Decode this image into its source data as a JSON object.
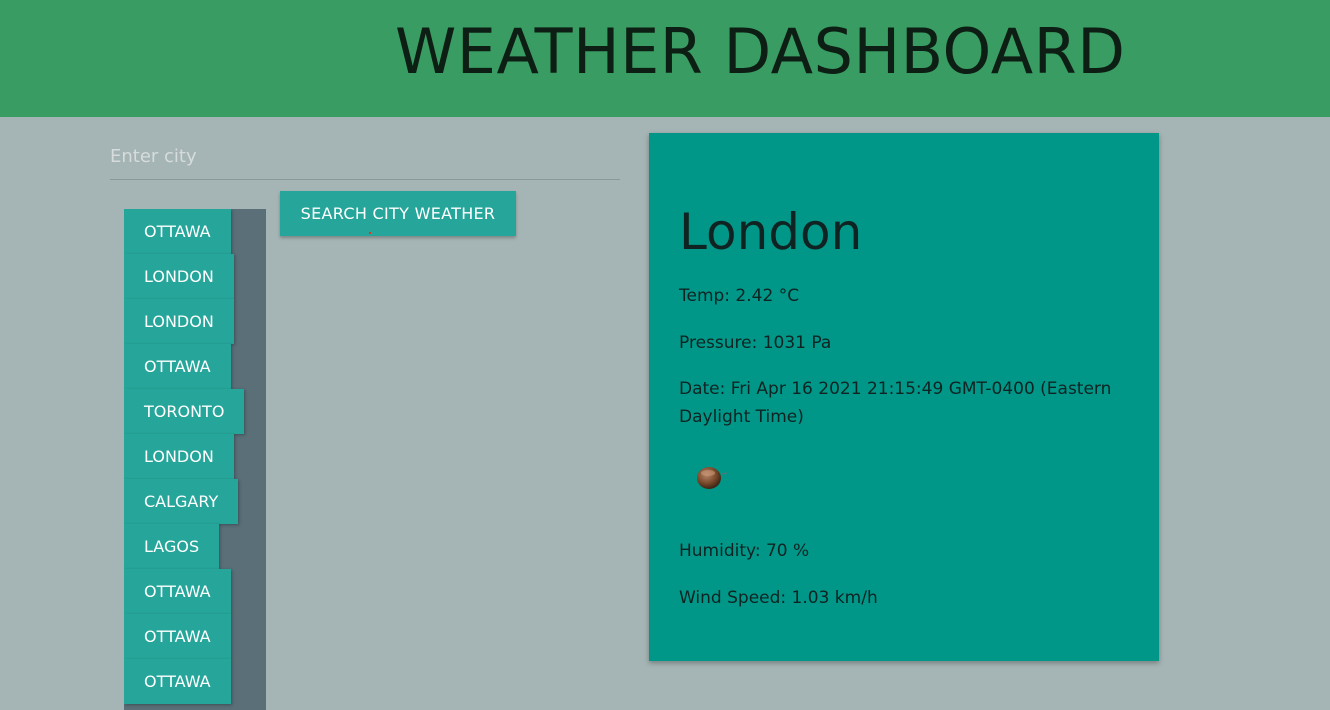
{
  "header": {
    "title": "WEATHER DASHBOARD"
  },
  "search": {
    "placeholder": "Enter city",
    "value": "",
    "button_label": "SEARCH CITY WEATHER"
  },
  "history": {
    "items": [
      {
        "label": "OTTAWA"
      },
      {
        "label": "LONDON"
      },
      {
        "label": "LONDON"
      },
      {
        "label": "OTTAWA"
      },
      {
        "label": "TORONTO"
      },
      {
        "label": "LONDON"
      },
      {
        "label": "CALGARY"
      },
      {
        "label": "LAGOS"
      },
      {
        "label": "OTTAWA"
      },
      {
        "label": "OTTAWA"
      },
      {
        "label": "OTTAWA"
      }
    ]
  },
  "weather": {
    "city": "London",
    "temp": "Temp: 2.42 °C",
    "pressure": "Pressure: 1031 Pa",
    "date": "Date: Fri Apr 16 2021 21:15:49 GMT-0400 (Eastern Daylight Time)",
    "icon": "weather-condition-icon",
    "humidity": "Humidity: 70 %",
    "wind": "Wind Speed: 1.03 km/h"
  },
  "colors": {
    "header_bg": "#399c62",
    "page_bg": "#a5b4b4",
    "button": "#26a69a",
    "card": "#009688",
    "history_panel": "#5a6f78"
  }
}
